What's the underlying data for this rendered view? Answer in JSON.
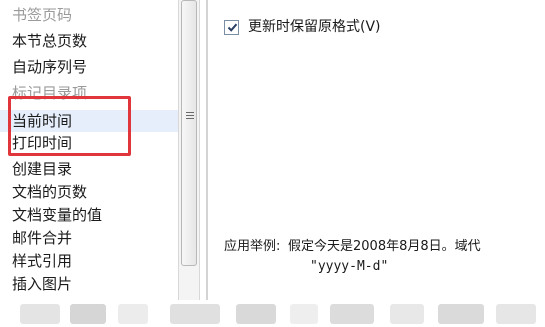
{
  "list": {
    "items": [
      {
        "label": "书签页码",
        "faded": true
      },
      {
        "label": "本节总页数",
        "faded": false
      },
      {
        "label": "自动序列号",
        "faded": false
      },
      {
        "label": "标记目录项",
        "faded": true
      },
      {
        "label": "当前时间",
        "faded": false,
        "selected": true
      },
      {
        "label": "打印时间",
        "faded": false
      },
      {
        "label": "创建目录",
        "faded": false
      },
      {
        "label": "文档的页数",
        "faded": false
      },
      {
        "label": "文档变量的值",
        "faded": false
      },
      {
        "label": "邮件合并",
        "faded": false
      },
      {
        "label": "样式引用",
        "faded": false
      },
      {
        "label": "插入图片",
        "faded": false
      }
    ],
    "highlight_color": "#e0353a",
    "selection_color": "#e6eefc"
  },
  "options": {
    "preserve_format": {
      "label": "更新时保留原格式(V)",
      "checked": true
    }
  },
  "example": {
    "label": "应用举例:",
    "text": "假定今天是2008年8月8日。域代",
    "format": "\"yyyy-M-d\""
  }
}
